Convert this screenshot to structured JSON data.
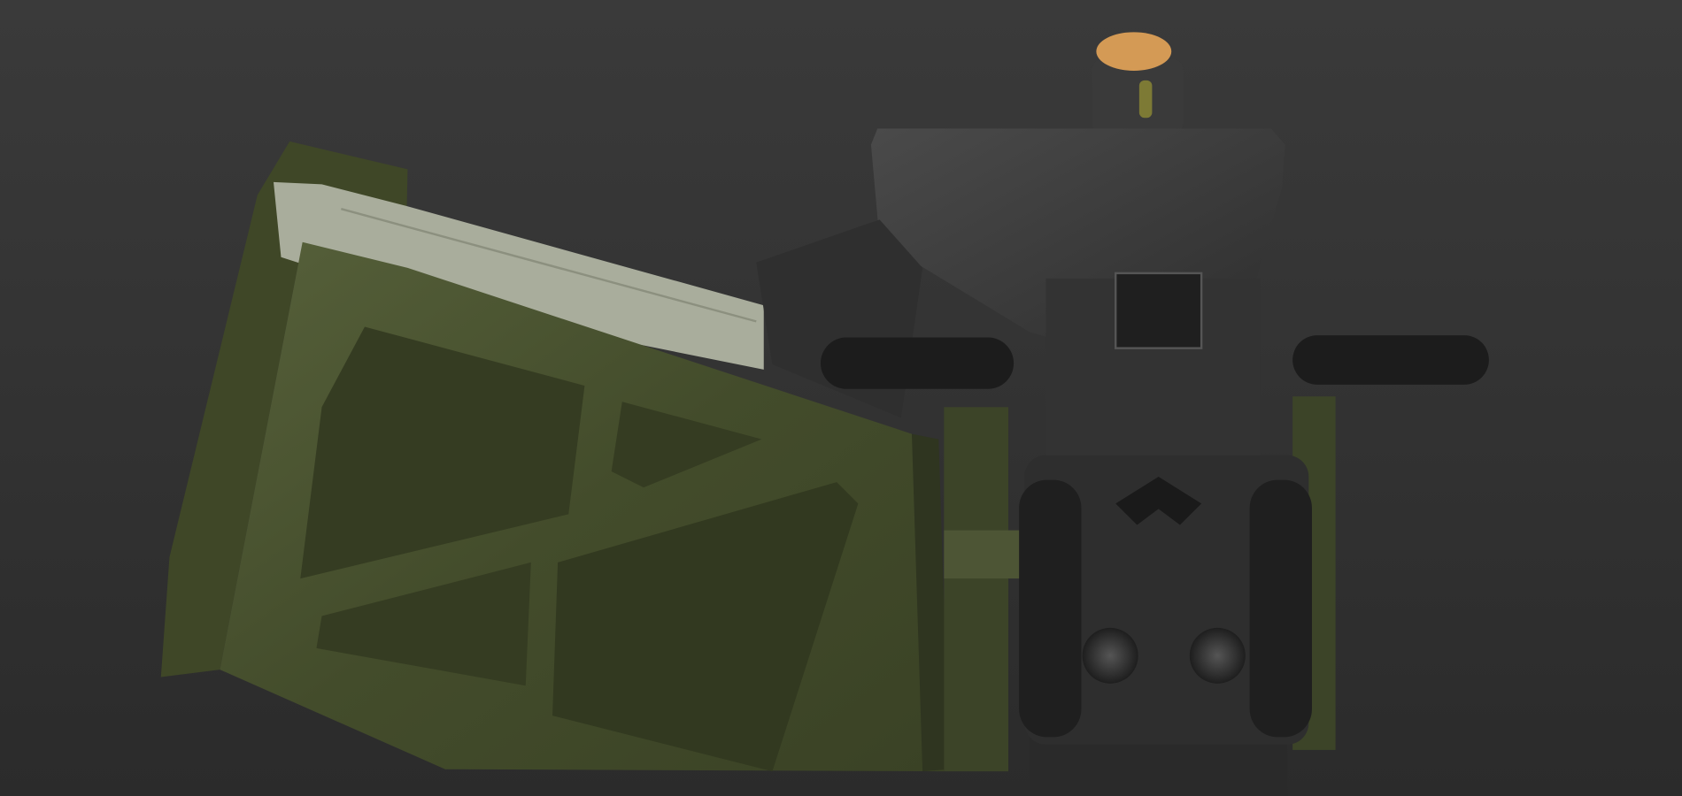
{
  "scene": {
    "subject": "",
    "colors": {
      "background_top": "#3a3a3a",
      "background_bottom": "#2b2b2b",
      "ammo_green": "#4b5530",
      "ammo_green_dark": "#353c22",
      "lid_gray": "#a9ad9c",
      "gun_metal": "#3d3d3d",
      "gun_dark": "#222222",
      "cap_orange": "#d49a55"
    }
  }
}
